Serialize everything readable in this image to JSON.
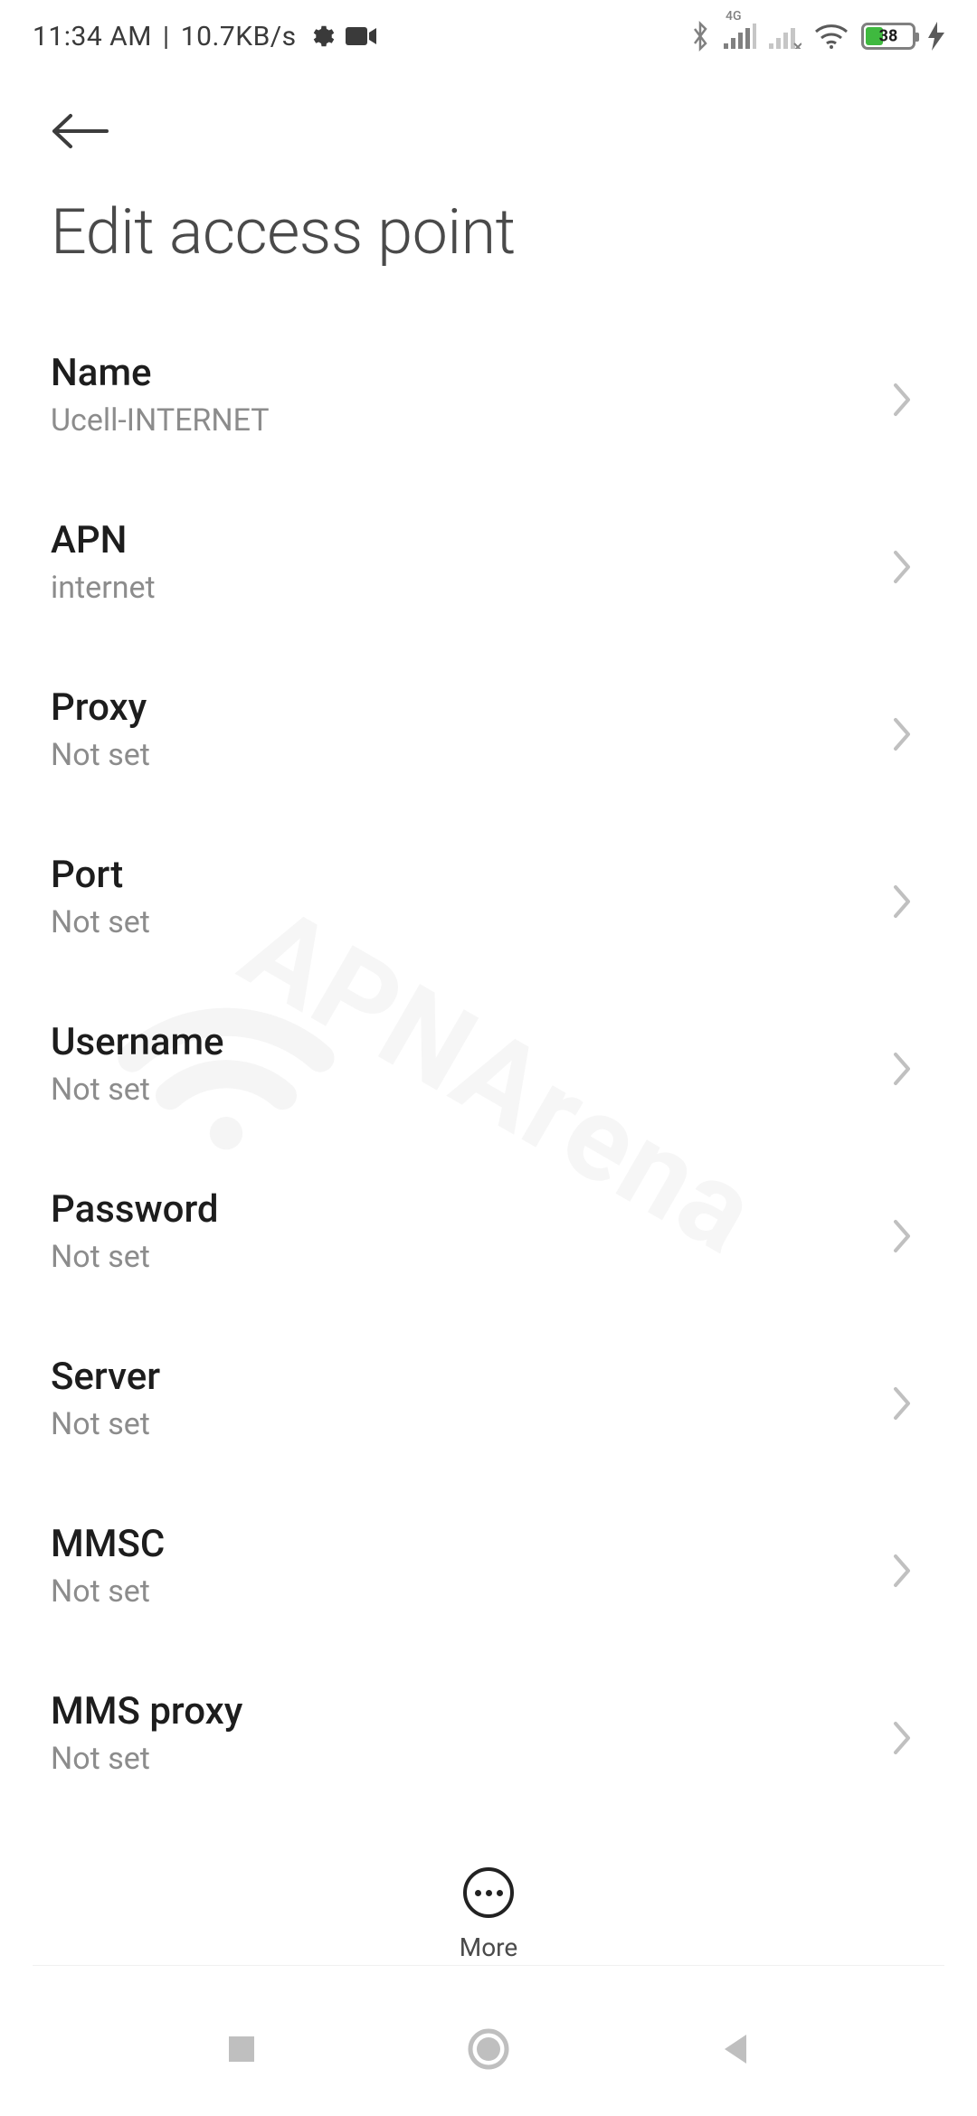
{
  "status": {
    "time": "11:34 AM",
    "sep": "|",
    "netspeed": "10.7KB/s",
    "signal_type": "4G",
    "battery_pct": "38"
  },
  "page": {
    "title": "Edit access point"
  },
  "settings": [
    {
      "label": "Name",
      "value": "Ucell-INTERNET",
      "key": "name"
    },
    {
      "label": "APN",
      "value": "internet",
      "key": "apn"
    },
    {
      "label": "Proxy",
      "value": "Not set",
      "key": "proxy"
    },
    {
      "label": "Port",
      "value": "Not set",
      "key": "port"
    },
    {
      "label": "Username",
      "value": "Not set",
      "key": "username"
    },
    {
      "label": "Password",
      "value": "Not set",
      "key": "password"
    },
    {
      "label": "Server",
      "value": "Not set",
      "key": "server"
    },
    {
      "label": "MMSC",
      "value": "Not set",
      "key": "mmsc"
    },
    {
      "label": "MMS proxy",
      "value": "Not set",
      "key": "mms-proxy"
    }
  ],
  "bottom": {
    "more": "More"
  },
  "watermark": "APNArena"
}
